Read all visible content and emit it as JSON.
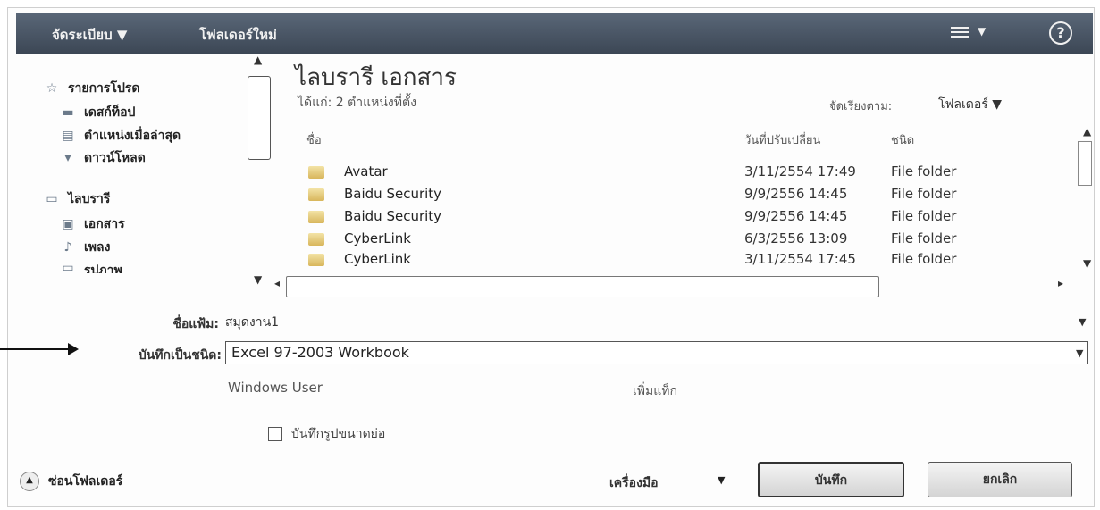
{
  "toolbar": {
    "organize_label": "จัดระเบียบ ▼",
    "new_folder_label": "โฟลเดอร์ใหม่",
    "view_icon": "view-list-icon",
    "help_icon": "?"
  },
  "nav": {
    "favorites_label": "รายการโปรด",
    "desktop_label": "เดสก์ท็อป",
    "recent_label": "ตำแหน่งเมื่อล่าสุด",
    "downloads_label": "ดาวน์โหลด",
    "libraries_label": "ไลบรารี",
    "documents_label": "เอกสาร",
    "music_label": "เพลง",
    "pictures_label": "รูปภาพ"
  },
  "library": {
    "title": "ไลบรารี เอกสาร",
    "subtitle": "ได้แก่: 2 ตำแหน่งที่ตั้ง",
    "arrange_label": "จัดเรียงตาม:",
    "arrange_value": "โฟลเดอร์ ▼"
  },
  "columns": {
    "name": "ชื่อ",
    "date": "วันที่ปรับเปลี่ยน",
    "type": "ชนิด"
  },
  "files": [
    {
      "name": "Avatar",
      "date": "3/11/2554 17:49",
      "type": "File folder"
    },
    {
      "name": "Baidu Security",
      "date": "9/9/2556 14:45",
      "type": "File folder"
    },
    {
      "name": "Baidu Security",
      "date": "9/9/2556 14:45",
      "type": "File folder"
    },
    {
      "name": "CyberLink",
      "date": "6/3/2556 13:09",
      "type": "File folder"
    },
    {
      "name": "CyberLink",
      "date": "3/11/2554 17:45",
      "type": "File folder"
    }
  ],
  "form": {
    "filename_label": "ชื่อแฟ้ม:",
    "filename_value": "สมุดงาน1",
    "filetype_label": "บันทึกเป็นชนิด:",
    "filetype_value": "Excel 97-2003 Workbook",
    "author_value": "Windows User",
    "tags_label": "เพิ่มแท็ก",
    "thumbnail_label": "บันทึกรูปขนาดย่อ"
  },
  "footer": {
    "hide_folders_label": "ซ่อนโฟลเดอร์",
    "tools_label": "เครื่องมือ",
    "save_label": "บันทึก",
    "cancel_label": "ยกเลิก"
  }
}
